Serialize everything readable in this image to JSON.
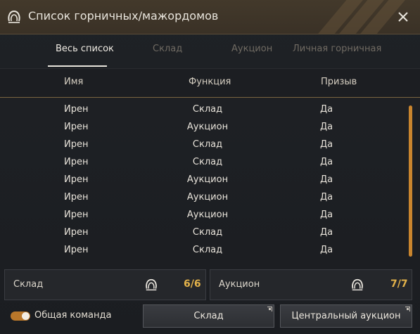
{
  "window": {
    "title": "Список горничных/мажордомов"
  },
  "tabs": [
    {
      "label": "Весь список",
      "active": true
    },
    {
      "label": "Склад",
      "active": false
    },
    {
      "label": "Аукцион",
      "active": false
    },
    {
      "label": "Личная горничная",
      "active": false
    }
  ],
  "table": {
    "headers": {
      "name": "Имя",
      "function": "Функция",
      "summon": "Призыв"
    },
    "rows": [
      {
        "name": "Ирен",
        "function": "Склад",
        "summon": "Да"
      },
      {
        "name": "Ирен",
        "function": "Аукцион",
        "summon": "Да"
      },
      {
        "name": "Ирен",
        "function": "Склад",
        "summon": "Да"
      },
      {
        "name": "Ирен",
        "function": "Склад",
        "summon": "Да"
      },
      {
        "name": "Ирен",
        "function": "Аукцион",
        "summon": "Да"
      },
      {
        "name": "Ирен",
        "function": "Аукцион",
        "summon": "Да"
      },
      {
        "name": "Ирен",
        "function": "Аукцион",
        "summon": "Да"
      },
      {
        "name": "Ирен",
        "function": "Склад",
        "summon": "Да"
      },
      {
        "name": "Ирен",
        "function": "Склад",
        "summon": "Да"
      }
    ]
  },
  "counters": {
    "storage": {
      "label": "Склад",
      "value": "6/6",
      "icon": "maid-icon"
    },
    "auction": {
      "label": "Аукцион",
      "value": "7/7",
      "icon": "maid-icon"
    }
  },
  "footer": {
    "toggle_label": "Общая команда",
    "toggle_on": true,
    "storage_button": "Склад",
    "auction_button": "Центральный аукцион"
  },
  "colors": {
    "accent": "#e3b24a",
    "toggle": "#b9772a",
    "titlebar": "#3f3529"
  }
}
